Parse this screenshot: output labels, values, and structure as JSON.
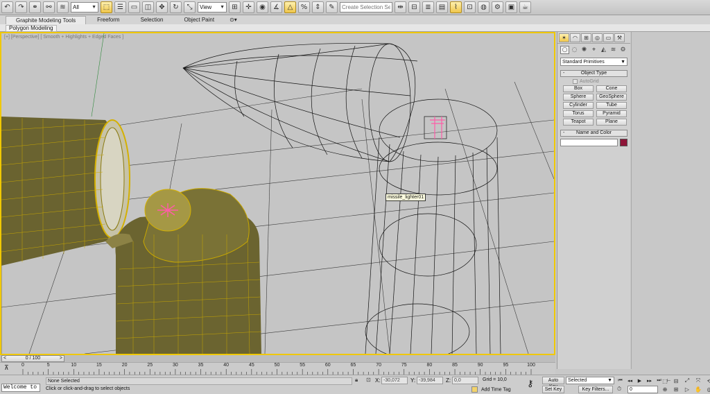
{
  "toolbar": {
    "selection_filter": "All",
    "ref_coord": "View",
    "named_selection_placeholder": "Create Selection Se",
    "icons_left": [
      "undo-icon",
      "redo-icon",
      "link-icon",
      "unlink-icon",
      "bind-space-warp-icon"
    ],
    "icons_mid": [
      "select-object-icon",
      "select-by-name-icon",
      "rect-selection-icon",
      "window-crossing-icon",
      "select-move-icon",
      "select-rotate-icon",
      "select-scale-icon"
    ],
    "icons_right": [
      "pivot-center-icon",
      "manipulate-icon",
      "snaps-toggle-icon",
      "angle-snap-icon",
      "percent-snap-icon",
      "spinner-snap-icon",
      "edit-named-sets-icon",
      "mirror-icon",
      "align-icon",
      "layer-manager-icon",
      "graphite-toggle-icon",
      "curve-editor-icon",
      "schematic-view-icon",
      "material-editor-icon",
      "render-setup-icon",
      "rendered-frame-icon",
      "render-icon"
    ]
  },
  "ribbon": {
    "tabs": [
      "Graphite Modeling Tools",
      "Freeform",
      "Selection",
      "Object Paint"
    ],
    "active_tab": 0,
    "panel_label": "Polygon Modeling"
  },
  "viewport": {
    "label": "[+] [Perspective] [ Smooth + Highlights + Edged Faces ]",
    "tooltip": "missile_lighter01"
  },
  "command_panel": {
    "tabs": [
      "create-tab-icon",
      "modify-tab-icon",
      "hierarchy-tab-icon",
      "motion-tab-icon",
      "display-tab-icon",
      "utilities-tab-icon"
    ],
    "category_icons": [
      "geometry-icon",
      "shapes-icon",
      "lights-icon",
      "cameras-icon",
      "helpers-icon",
      "space-warps-icon",
      "systems-icon"
    ],
    "category_dropdown": "Standard Primitives",
    "object_type_title": "Object Type",
    "autogrid_label": "AutoGrid",
    "primitives": [
      "Box",
      "Cone",
      "Sphere",
      "GeoSphere",
      "Cylinder",
      "Tube",
      "Torus",
      "Pyramid",
      "Teapot",
      "Plane"
    ],
    "name_color_title": "Name and Color",
    "object_name": "",
    "color": "#8e1538"
  },
  "timeline": {
    "frame_readout": "0 / 100",
    "ticks": [
      0,
      5,
      10,
      15,
      20,
      25,
      30,
      35,
      40,
      45,
      50,
      55,
      60,
      65,
      70,
      75,
      80,
      85,
      90,
      95,
      100
    ]
  },
  "status": {
    "maxscript": "Welcome to M",
    "selection_msg": "None Selected",
    "prompt_msg": "Click or click-and-drag to select objects",
    "x_label": "X:",
    "x_value": "-30,072",
    "y_label": "Y:",
    "y_value": "-39,984",
    "z_label": "Z:",
    "z_value": "0,0",
    "grid": "Grid = 10,0",
    "add_time_tag": "Add Time Tag",
    "auto_key": "Auto Key",
    "set_key": "Set Key",
    "key_mode": "Selected",
    "key_filters": "Key Filters...",
    "current_frame": "0"
  }
}
